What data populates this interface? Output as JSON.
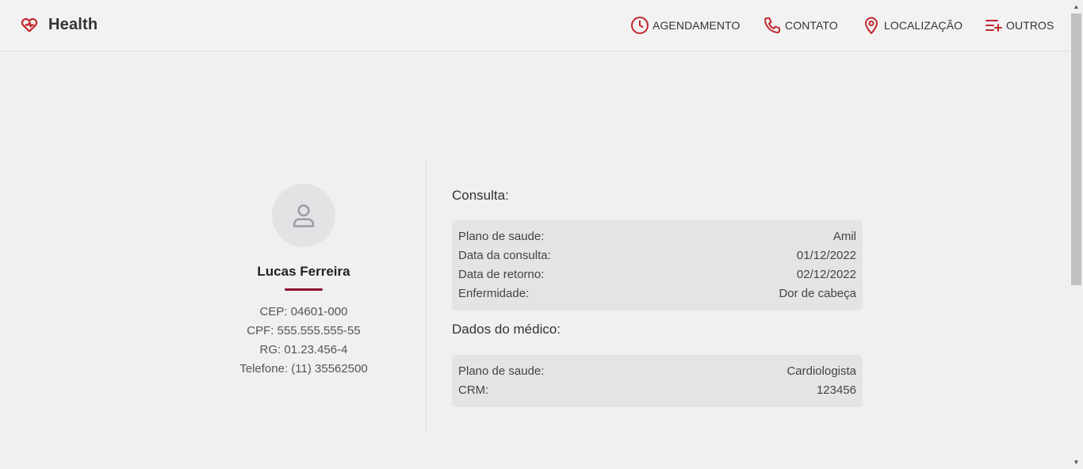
{
  "brand": {
    "name": "Health",
    "accent": "#c1272d"
  },
  "nav": [
    {
      "label": "AGENDAMENTO",
      "icon": "clock-icon"
    },
    {
      "label": "CONTATO",
      "icon": "phone-icon"
    },
    {
      "label": "LOCALIZAÇÃO",
      "icon": "map-pin-icon"
    },
    {
      "label": "OUTROS",
      "icon": "list-plus-icon"
    }
  ],
  "profile": {
    "name": "Lucas Ferreira",
    "underline_color": "#8c0f2e",
    "cep": "CEP: 04601-000",
    "cpf": "CPF: 555.555.555-55",
    "rg": "RG: 01.23.456-4",
    "telefone": "Telefone: (11) 35562500"
  },
  "consulta": {
    "title": "Consulta:",
    "rows": [
      {
        "label": "Plano de saude:",
        "value": "Amil"
      },
      {
        "label": "Data da consulta:",
        "value": "01/12/2022"
      },
      {
        "label": "Data de retorno:",
        "value": "02/12/2022"
      },
      {
        "label": "Enfermidade:",
        "value": "Dor de cabeça"
      }
    ]
  },
  "medico": {
    "title": "Dados do médico:",
    "rows": [
      {
        "label": "Plano de saude:",
        "value": "Cardiologista"
      },
      {
        "label": "CRM:",
        "value": "123456"
      }
    ]
  }
}
